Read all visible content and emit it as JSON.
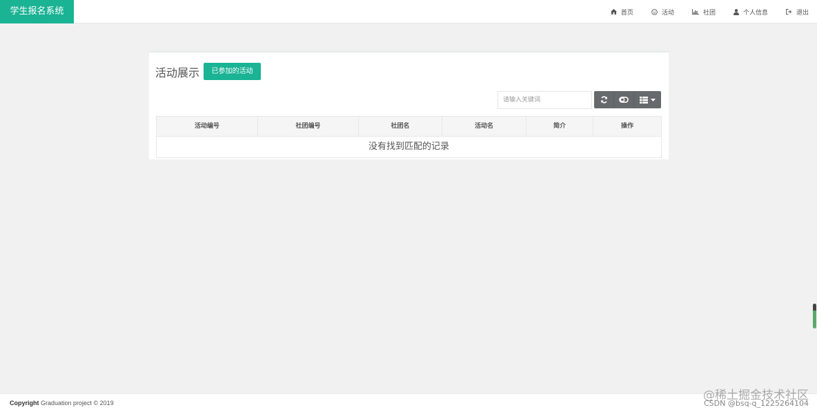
{
  "brand": {
    "title": "学生报名系统",
    "color": "#1ab394"
  },
  "nav": [
    {
      "label": "首页",
      "icon": "home-icon"
    },
    {
      "label": "活动",
      "icon": "smile-icon"
    },
    {
      "label": "社团",
      "icon": "bar-chart-icon"
    },
    {
      "label": "个人信息",
      "icon": "user-icon"
    },
    {
      "label": "退出",
      "icon": "sign-out-icon"
    }
  ],
  "panel": {
    "title": "活动展示",
    "joined_button": "已参加的活动",
    "search_placeholder": "请输入关键词",
    "toolbar": [
      {
        "icon": "refresh-icon"
      },
      {
        "icon": "toggle-icon"
      },
      {
        "icon": "columns-icon"
      }
    ]
  },
  "table": {
    "columns": [
      "活动编号",
      "社团编号",
      "社团名",
      "活动名",
      "简介",
      "操作"
    ],
    "empty_text": "没有找到匹配的记录"
  },
  "footer": {
    "copyright_label": "Copyright",
    "text": " Graduation project © 2019"
  },
  "watermark": {
    "line1": "@稀土掘金技术社区",
    "line2": "CSDN @bsq-q_1225264104"
  }
}
